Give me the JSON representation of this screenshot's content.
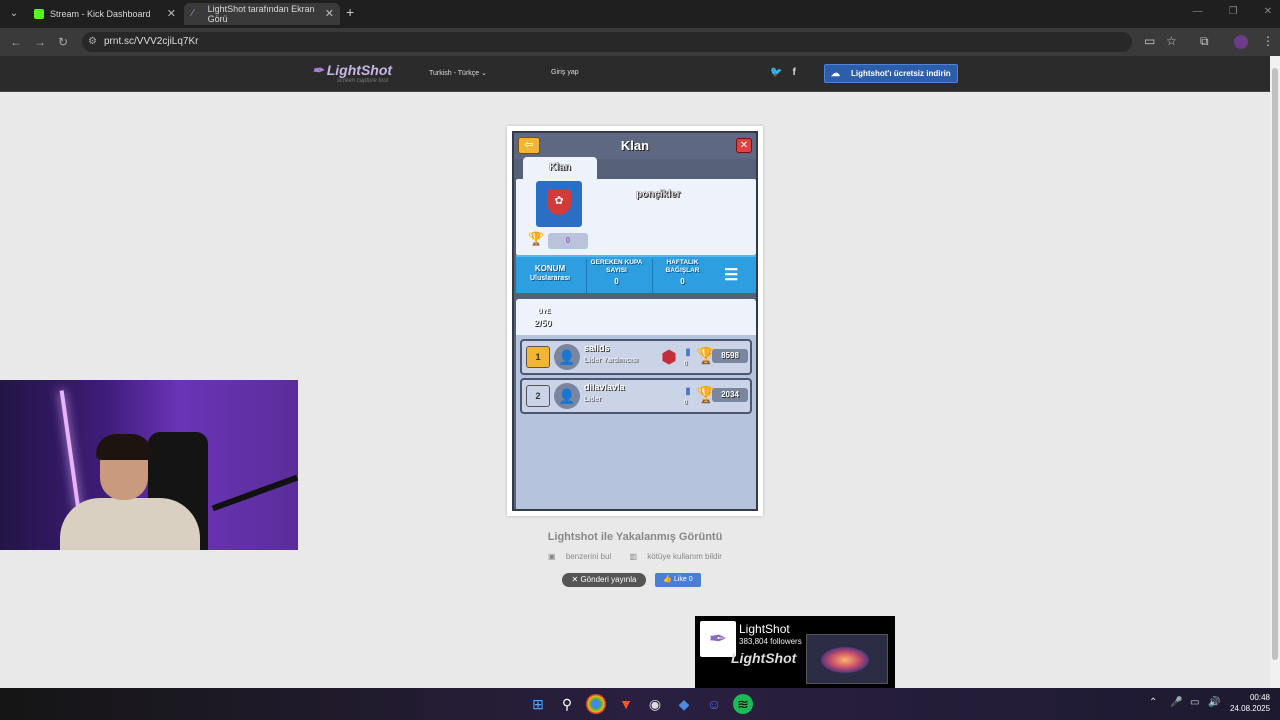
{
  "browser": {
    "tabs": [
      {
        "label": "Stream - Kick Dashboard"
      },
      {
        "label": "LightShot tarafından Ekran Görü"
      }
    ],
    "url": "prnt.sc/VVV2cjiLq7Kr"
  },
  "lightshot": {
    "logo": "LightShot",
    "logo_sub": "screen capture tool",
    "language": "Turkish - Türkçe",
    "login": "Giriş yap",
    "download": "Lightshot'ı ücretsiz indirin",
    "caption": "Lightshot ile Yakalanmış Görüntü",
    "similar": "benzerini bul",
    "report": "kötüye kullanım bildir",
    "tweet": "Gönderi yayınla",
    "like": "Like 0",
    "fb": {
      "name": "LightShot",
      "followers": "383,804 followers",
      "brand": "LightShot"
    }
  },
  "game": {
    "title": "Klan",
    "tab": "Klan",
    "clan_name": "ponçikler",
    "clan_score": "0",
    "stats": [
      {
        "label": "KONUM",
        "value": "Uluslararası"
      },
      {
        "label": "GEREKEN KUPA SAYISI",
        "value": "0"
      },
      {
        "label": "HAFTALIK BAĞIŞLAR",
        "value": "0"
      }
    ],
    "members_label": "ÜYE",
    "members_count": "2/50",
    "members": [
      {
        "rank": "1",
        "name": "salids",
        "role": "Lider Yardımcısı",
        "cards": "0",
        "trophies": "8598"
      },
      {
        "rank": "2",
        "name": "dilavlavla",
        "role": "Lider",
        "cards": "0",
        "trophies": "2034"
      }
    ]
  },
  "taskbar": {
    "time": "00:48",
    "date": "24.08.2025"
  }
}
